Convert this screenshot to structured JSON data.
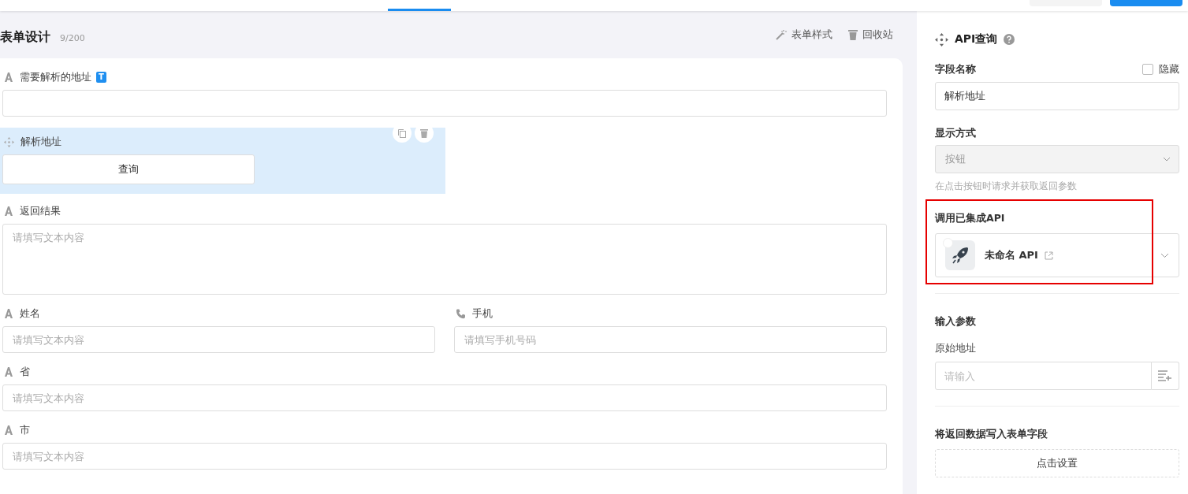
{
  "canvas": {
    "title": "表单设计",
    "count": "9/200",
    "actions": [
      {
        "kind": "style",
        "label": "表单样式"
      },
      {
        "kind": "trash",
        "label": "回收站"
      }
    ]
  },
  "form_fields": [
    {
      "kind": "text",
      "label": "需要解析的地址",
      "tag": "T",
      "half": false,
      "selected": false
    },
    {
      "kind": "button",
      "label": "解析地址",
      "button": "查询",
      "half": false,
      "selected": true
    },
    {
      "kind": "textarea",
      "label": "返回结果",
      "placeholder": "请填写文本内容",
      "half": false,
      "selected": false
    },
    {
      "kind": "text",
      "label": "姓名",
      "placeholder": "请填写文本内容",
      "half": true,
      "selected": false
    },
    {
      "kind": "phone",
      "label": "手机",
      "placeholder": "请填写手机号码",
      "half": true,
      "selected": false
    },
    {
      "kind": "text",
      "label": "省",
      "placeholder": "请填写文本内容",
      "half": false,
      "selected": false
    },
    {
      "kind": "text",
      "label": "市",
      "placeholder": "请填写文本内容",
      "half": false,
      "selected": false
    }
  ],
  "panel": {
    "title": "API查询",
    "field_name_label": "字段名称",
    "hidden": {
      "label": "隐藏",
      "checked": false
    },
    "field_name_value": "解析地址",
    "display_label": "显示方式",
    "display_value": "按钮",
    "display_disabled": true,
    "display_hint": "在点击按钮时请求并获取返回参数",
    "api_label": "调用已集成API",
    "api_name": "未命名 API",
    "input_params_label": "输入参数",
    "params": [
      {
        "label": "原始地址",
        "placeholder": "请输入"
      }
    ],
    "output_label": "将返回数据写入表单字段",
    "output_button": "点击设置"
  }
}
